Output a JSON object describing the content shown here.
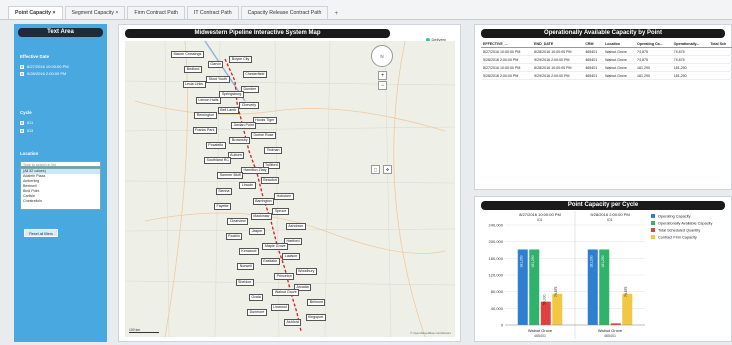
{
  "tabs": [
    {
      "label": "Point Capacity",
      "closable": true,
      "active": true
    },
    {
      "label": "Segment Capacity",
      "closable": true,
      "active": false
    },
    {
      "label": "Firm Contract Path",
      "closable": false,
      "active": false
    },
    {
      "label": "IT Contract Path",
      "closable": false,
      "active": false
    },
    {
      "label": "Capacity Release Contract Path",
      "closable": false,
      "active": false
    }
  ],
  "tab_add": "+",
  "left_panel": {
    "title": "Text Area",
    "effective_date_label": "Effective Date",
    "effective_dates": [
      "8/27/2016 10:00:00 PM",
      "9/28/2016 2:00:00 PM"
    ],
    "cycle_label": "Cycle",
    "cycles": [
      "ID1",
      "ID3"
    ],
    "location_label": "Location",
    "search_placeholder": "Type to search in list",
    "locations": [
      "(All 52 values)",
      "Adaleth Plaza",
      "Amberling",
      "Beetwell",
      "Birdi Point",
      "Carlisle",
      "Chestrelloin"
    ],
    "reset_button": "Reset all filters"
  },
  "map": {
    "title": "Midwestern Pipeline Interactive System Map",
    "legend": [
      {
        "label": "Delivery",
        "color": "#3bbfa8"
      },
      {
        "label": "Receipt",
        "color": "#1aa34a"
      }
    ],
    "cities": [
      "Macon Crossings",
      "Boyne City",
      "Garvin",
      "Bedford",
      "Chesterfield",
      "Stout Youth",
      "Lecia Links",
      "Dundee",
      "Springsburg",
      "Lemon Halls",
      "Cheverly",
      "Bell Lamb",
      "Remington",
      "Hooks Tiger",
      "Jordan Point",
      "Franks Park",
      "Dorine Rose",
      "Brownsby",
      "Pocatello",
      "Tedman",
      "Auburn",
      "Southland RC",
      "Tulliford",
      "Hamilton Zlaty",
      "Sumner Bluff",
      "Beaufort",
      "Lincoln",
      "Sienna",
      "Hoboken",
      "Barrington",
      "Fayette",
      "Spruce",
      "Mackinaw",
      "Clearview",
      "Ashdown",
      "Jasper",
      "Rocklin",
      "Hartford",
      "Maple Grove",
      "Kenwood",
      "Lawson",
      "Eastlake",
      "Norwell",
      "Woodbury",
      "Princeton",
      "Sheldon",
      "Arcadia",
      "Walnut Grove",
      "Ocala",
      "Belmont",
      "Linwood",
      "Dunmore",
      "Kingsport",
      "Ashford"
    ],
    "nav_label": "N",
    "zoom_in": "+",
    "zoom_out": "−",
    "scale_label": "100 km",
    "attribution": "© OpenStreetMap contributors"
  },
  "table": {
    "title": "Operationally Available Capacity by Point",
    "headers": [
      "EFFECTIVE_...",
      "END_DATE",
      "CRM",
      "Location",
      "Operating Ca...",
      "Operationally...",
      "Total Sch"
    ],
    "rows": [
      [
        "8/27/2016 10:00:00 PM",
        "8/28/2016 10:00:00 PM",
        "465401",
        "Walnut Grove",
        "74,875",
        "74,875",
        ""
      ],
      [
        "9/28/2016 2:00:00 PM",
        "9/29/2016 2:00:00 PM",
        "465401",
        "Walnut Grove",
        "74,875",
        "74,875",
        ""
      ],
      [
        "8/27/2016 10:00:00 PM",
        "8/28/2016 10:00:00 PM",
        "465401",
        "Walnut Grove",
        "181,290",
        "181,290",
        ""
      ],
      [
        "9/28/2016 2:00:00 PM",
        "9/29/2016 2:00:00 PM",
        "465401",
        "Walnut Grove",
        "181,290",
        "181,290",
        ""
      ]
    ]
  },
  "chart_data": {
    "type": "bar",
    "title": "Point Capacity per Cycle",
    "groups": [
      {
        "header": "8/27/2016 10:00:00 PM",
        "subheader": "ID1",
        "category": "Walnut Grove",
        "code": "465401"
      },
      {
        "header": "9/28/2016 2:00:00 PM",
        "subheader": "ID1",
        "category": "Walnut Grove",
        "code": "465401"
      }
    ],
    "series": [
      {
        "name": "Operating Capacity",
        "color": "#2e7fd1",
        "values": [
          181290,
          181290
        ]
      },
      {
        "name": "Operationally Available Capacity",
        "color": "#2fb36b",
        "values": [
          181290,
          181290
        ]
      },
      {
        "name": "Total Scheduled Quantity",
        "color": "#e04040",
        "values": [
          56000,
          4000
        ]
      },
      {
        "name": "Contract Firm Capacity",
        "color": "#f2c744",
        "values": [
          74875,
          74875
        ]
      }
    ],
    "bar_labels": [
      [
        "181,290",
        "181,290",
        "56,000",
        "74,875"
      ],
      [
        "181,290",
        "181,290",
        "",
        "74,875"
      ]
    ],
    "yticks": [
      "0",
      "40,000",
      "80,000",
      "120,000",
      "160,000",
      "200,000",
      "240,000"
    ],
    "ylim": [
      0,
      240000
    ],
    "legend_position": "right"
  }
}
